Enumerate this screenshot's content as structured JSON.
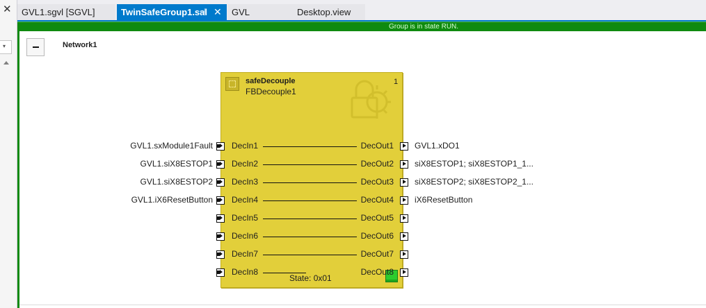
{
  "tabs": [
    {
      "label": "GVL1.sgvl [SGVL]",
      "active": false
    },
    {
      "label": "TwinSafeGroup1.sal",
      "active": true
    },
    {
      "label": "GVL",
      "active": false
    },
    {
      "label": "Desktop.view",
      "active": false
    }
  ],
  "status_banner": "Group is in state RUN.",
  "network": {
    "title": "Network1"
  },
  "function_block": {
    "type": "safeDecouple",
    "instance": "FBDecouple1",
    "number": "1",
    "state": "State: 0x01"
  },
  "rows": [
    {
      "input_var": "GVL1.sxModule1Fault",
      "input_port": "DecIn1",
      "output_port": "DecOut1",
      "output_var": "GVL1.xDO1"
    },
    {
      "input_var": "GVL1.siX8ESTOP1",
      "input_port": "DecIn2",
      "output_port": "DecOut2",
      "output_var": "siX8ESTOP1; siX8ESTOP1_1..."
    },
    {
      "input_var": "GVL1.siX8ESTOP2",
      "input_port": "DecIn3",
      "output_port": "DecOut3",
      "output_var": "siX8ESTOP2; siX8ESTOP2_1..."
    },
    {
      "input_var": "GVL1.iX6ResetButton",
      "input_port": "DecIn4",
      "output_port": "DecOut4",
      "output_var": "iX6ResetButton"
    },
    {
      "input_var": "",
      "input_port": "DecIn5",
      "output_port": "DecOut5",
      "output_var": ""
    },
    {
      "input_var": "",
      "input_port": "DecIn6",
      "output_port": "DecOut6",
      "output_var": ""
    },
    {
      "input_var": "",
      "input_port": "DecIn7",
      "output_port": "DecOut7",
      "output_var": ""
    },
    {
      "input_var": "",
      "input_port": "DecIn8",
      "output_port": "DecOut8",
      "output_var": ""
    }
  ],
  "colors": {
    "accent": "#007acc",
    "run_state": "#0f8a0f",
    "block_fill": "#e2cf3a",
    "led_on": "#2ecc2e"
  },
  "icons": [
    "close-icon",
    "pin-icon",
    "dropdown-arrow-icon",
    "scroll-up-icon",
    "safety-block-icon",
    "gear-lock-watermark-icon",
    "input-pin-icon",
    "output-pin-icon",
    "status-led-icon"
  ]
}
